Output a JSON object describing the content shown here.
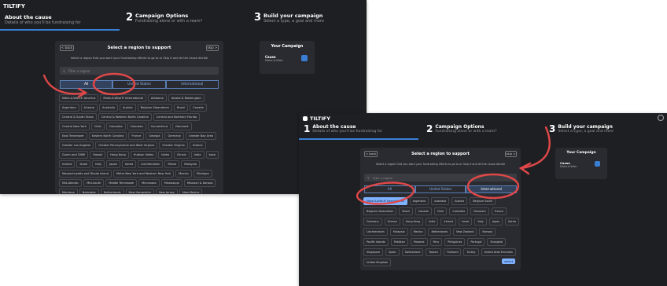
{
  "brand": "TILTIFY",
  "steps": [
    {
      "num": "",
      "title": "About the cause",
      "sub": "Details of who you'll be fundraising for"
    },
    {
      "num": "2",
      "title": "Campaign Options",
      "sub": "Fundraising alone or with a team?"
    },
    {
      "num": "3",
      "title": "Build your campaign",
      "sub": "Select a type, a goal and more"
    }
  ],
  "steps2": [
    {
      "num": "1",
      "title": "About the cause",
      "sub": "Details of who you'll be fundraising for"
    },
    {
      "num": "2",
      "title": "Campaign Options",
      "sub": "Fundraising alone or with a team?"
    },
    {
      "num": "3",
      "title": "Build your campaign",
      "sub": "Select a type, a goal and more"
    }
  ],
  "region": {
    "back": "< back",
    "skip": "skip >",
    "title": "Select a region to support",
    "desc": "Select a region that you want your fundraising efforts to go to or Skip it and let the cause decide",
    "search_placeholder": "Filter a region",
    "search_placeholder2": "Type a region",
    "tabs": [
      "All",
      "United States",
      "International"
    ],
    "select": "select"
  },
  "side": {
    "title": "Your Campaign",
    "cause_label": "Cause",
    "cause_value": "Make-A-Wish"
  },
  "chips1": [
    "Make-A-Wish® America",
    "Make-A-Wish® International",
    "Alabama",
    "Alaska & Washington",
    "Argentina",
    "Arizona",
    "Australia",
    "Austria",
    "Belgium Vlaanderen",
    "Brazil",
    "Canada",
    "Central & South Texas",
    "Central & Western North Carolina",
    "Central and Northern Florida",
    "Central New York",
    "Chile",
    "Colombia",
    "Colorado",
    "Connecticut",
    "Denmark",
    "East Tennessee",
    "Eastern North Carolina",
    "France",
    "Georgia",
    "Germany",
    "Greater Bay Area",
    "Greater Los Angeles",
    "Greater Pennsylvania and West Virginia",
    "Greater Virginia",
    "Greece",
    "Guam and CNMI",
    "Hawaii",
    "Hong Kong",
    "Hudson Valley",
    "Idaho",
    "Illinois",
    "India",
    "Iowa",
    "Ireland",
    "Israel",
    "Italy",
    "Japan",
    "Korea",
    "Liechtenstein",
    "Maine",
    "Malaysia",
    "Massachusetts and Rhode Island",
    "Metro New York and Western New York",
    "Mexico",
    "Michigan",
    "Mid-Atlantic",
    "Mid-South",
    "Middle Tennessee",
    "Minnesota",
    "Mississippi",
    "Missouri & Kansas",
    "Montana",
    "Nebraska",
    "Netherlands",
    "New Hampshire",
    "New Jersey",
    "New Mexico",
    "New Zealand",
    "North Dakota",
    "North Texas",
    "Northeast New York"
  ],
  "chips2": [
    "Make-A-Wish® International",
    "Argentina",
    "Australia",
    "Austria",
    "Belgium South",
    "Belgium Vlaanderen",
    "Brazil",
    "Canada",
    "Chile",
    "Colombia",
    "Denmark",
    "France",
    "Germany",
    "Greece",
    "Hong Kong",
    "India",
    "Ireland",
    "Israel",
    "Italy",
    "Japan",
    "Korea",
    "Liechtenstein",
    "Malaysia",
    "Mexico",
    "Netherlands",
    "New Zealand",
    "Norway",
    "Pacific Islands",
    "Pakistan",
    "Panama",
    "Peru",
    "Philippines",
    "Portugal",
    "Shanghai",
    "Singapore",
    "Spain",
    "Switzerland",
    "Taiwan",
    "Thailand",
    "Turkey",
    "United Arab Emirates",
    "United Kingdom"
  ],
  "colors": {
    "accent": "#3a7fd5",
    "annotation": "#e04848",
    "bg": "#1e1f23",
    "card": "#2a2b31"
  }
}
